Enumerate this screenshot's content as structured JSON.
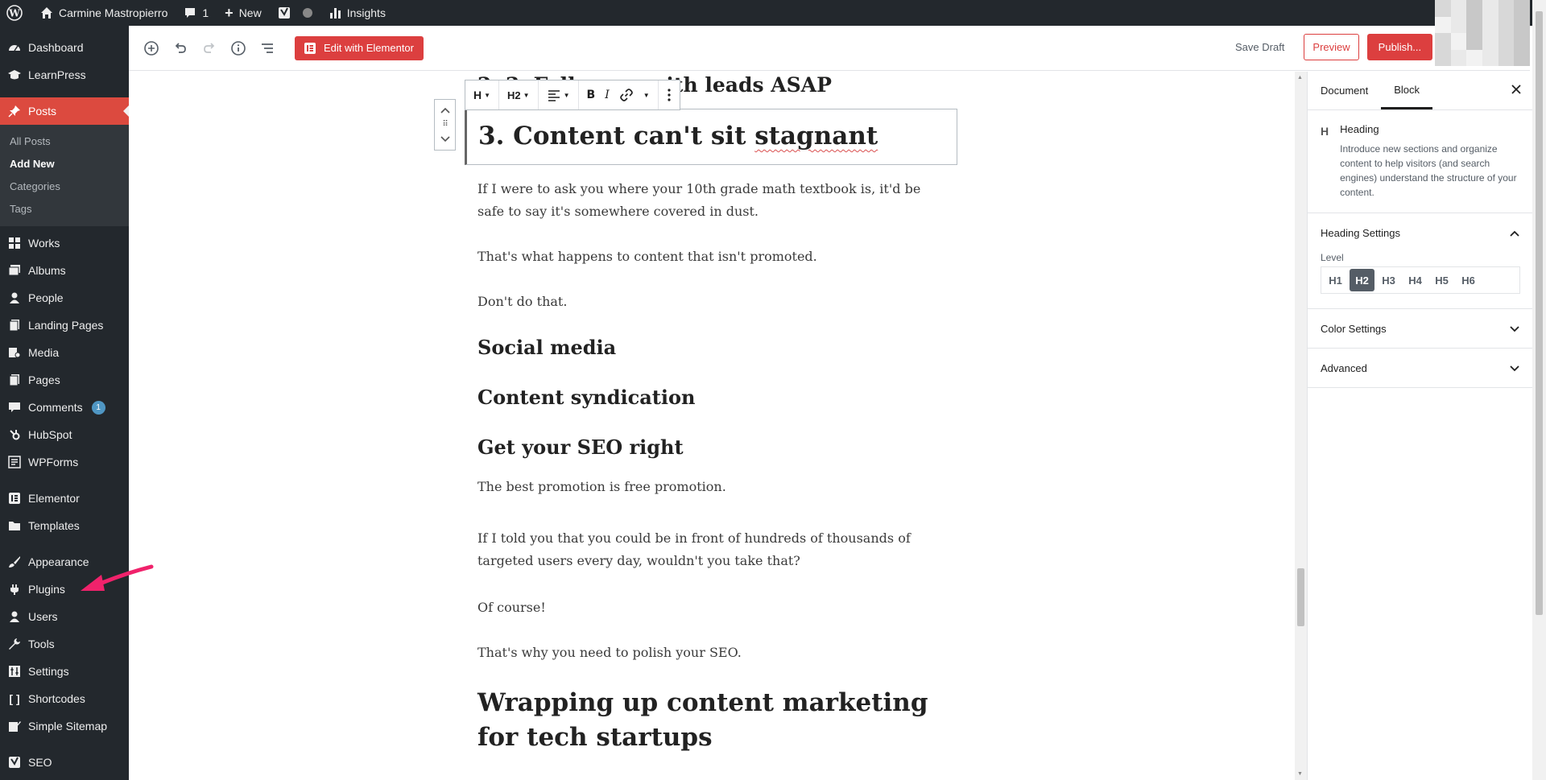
{
  "adminbar": {
    "site_name": "Carmine Mastropierro",
    "comments_count": "1",
    "new_label": "New",
    "insights_label": "Insights"
  },
  "menu": {
    "dashboard": "Dashboard",
    "learnpress": "LearnPress",
    "posts": "Posts",
    "submenu": [
      "All Posts",
      "Add New",
      "Categories",
      "Tags"
    ],
    "works": "Works",
    "albums": "Albums",
    "people": "People",
    "landing_pages": "Landing Pages",
    "media": "Media",
    "pages": "Pages",
    "comments": "Comments",
    "comments_badge": "1",
    "hubspot": "HubSpot",
    "wpforms": "WPForms",
    "elementor": "Elementor",
    "templates": "Templates",
    "appearance": "Appearance",
    "plugins": "Plugins",
    "users": "Users",
    "tools": "Tools",
    "settings": "Settings",
    "shortcodes": "Shortcodes",
    "simple_sitemap": "Simple Sitemap",
    "seo": "SEO"
  },
  "header": {
    "elementor_label": "Edit with Elementor",
    "save_draft": "Save Draft",
    "preview": "Preview",
    "publish": "Publish..."
  },
  "toolbar": {
    "heading_icon": "H",
    "level": "H2"
  },
  "content": {
    "prev_heading": "2. 3. Follow up with leads ASAP",
    "selected_heading_main": "3. Content can't sit ",
    "selected_heading_misspelled": "stagnant",
    "p1": "If I were to ask you where your 10th grade math textbook is, it'd be safe to say it's somewhere covered in dust.",
    "p2": "That's what happens to content that isn't promoted.",
    "p3": "Don't do that.",
    "h_social": "Social media",
    "h_syndication": "Content syndication",
    "h_seo": "Get your SEO right",
    "p4": "The best promotion is free promotion.",
    "p5": "If I told you that you could be in front of hundreds of thousands of targeted users every day, wouldn't you take that?",
    "p6": "Of course!",
    "p7": "That's why you need to polish your SEO.",
    "h_wrap": "Wrapping up content marketing for tech startups"
  },
  "sidebar": {
    "tab_document": "Document",
    "tab_block": "Block",
    "block_icon": "H",
    "block_title": "Heading",
    "block_desc": "Introduce new sections and organize content to help visitors (and search engines) understand the structure of your content.",
    "heading_settings": "Heading Settings",
    "level_label": "Level",
    "levels": [
      "H1",
      "H2",
      "H3",
      "H4",
      "H5",
      "H6"
    ],
    "color_settings": "Color Settings",
    "advanced": "Advanced"
  },
  "colors": {
    "admin_bg": "#23282d",
    "accent_red": "#dc3f3f",
    "annotation_pink": "#f0226b"
  }
}
